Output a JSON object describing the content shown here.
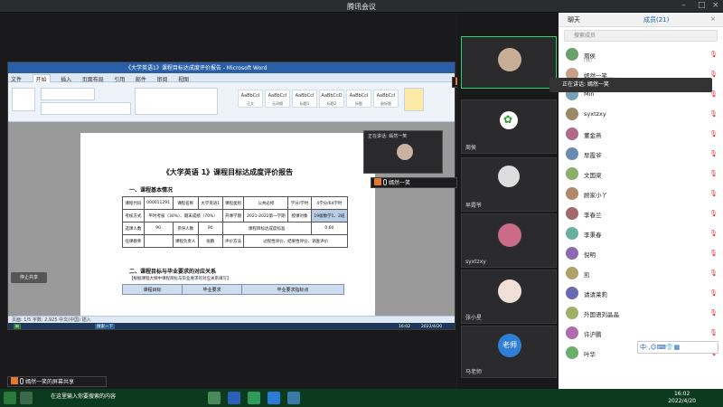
{
  "app": {
    "title": "腾讯会议"
  },
  "word": {
    "title": "《大学英语1》课程目标达成度评价报告 - Microsoft Word",
    "tabs": [
      "文件",
      "开始",
      "插入",
      "页面布局",
      "引用",
      "邮件",
      "审阅",
      "视图"
    ],
    "styles": [
      {
        "sample": "AaBbCcI",
        "name": "正文"
      },
      {
        "sample": "AaBbCcI",
        "name": "无间隔"
      },
      {
        "sample": "AaBbCcI",
        "name": "标题1"
      },
      {
        "sample": "AaBbCcD",
        "name": "标题2"
      },
      {
        "sample": "AaBbCcI",
        "name": "标题"
      },
      {
        "sample": "AaBbCcI",
        "name": "副标题"
      }
    ],
    "doc": {
      "title": "《大学英语 1》课程目标达成度评价报告",
      "sec1": "一、课程基本情况",
      "row1": [
        "课程代码",
        "000011291",
        "课程名称",
        "大学英语1",
        "课程类别",
        "公共必修",
        "学分/学时",
        "4学分/64学时"
      ],
      "row2": [
        "考核方式",
        "平时考核（30%）、期末成绩（70%）",
        "开课学期",
        "2021-2022第一学期",
        "授课对象",
        "19级数学1、2班"
      ],
      "row3": [
        "选课人数",
        "90",
        "参评人数",
        "90",
        "课程目标达成度标准",
        "0.60"
      ],
      "row4": [
        "任课教师",
        "",
        "课程负责人",
        "张鹏",
        "评价方法",
        "过程性评价、结果性评价、调查评价"
      ],
      "sec2": "二、课程目标与毕业要求的对应关系",
      "note": "【根据课程大纲中课程目标与毕业要求的对应关系填写】",
      "gheaders": [
        "课程目标",
        "毕业要求",
        "毕业要求指标点"
      ],
      "status": "页面: 1/5   字数: 2,925   中文(中国)   插入"
    },
    "stop_share": "停止共享",
    "task_start": "搜索一下",
    "task_time": "16:02",
    "task_date": "2022/4/20"
  },
  "share_label": "嫣然一笑的屏幕共享",
  "speaking": "正在讲话: 嫣然一笑",
  "speaker_name": "嫣然一笑",
  "videos": [
    {
      "name": ""
    },
    {
      "name": "周侯"
    },
    {
      "name": "早霞爷"
    },
    {
      "name": "syxtzxy"
    },
    {
      "name": "张小星"
    },
    {
      "name": "马老师",
      "badge": "老师"
    }
  ],
  "panel": {
    "tab_chat": "聊天",
    "tab_members": "成员(21)",
    "search_placeholder": "搜索成员",
    "members": [
      {
        "name": "周侯",
        "role": "(我)"
      },
      {
        "name": "嫣然一笑",
        "role": "(主持人，屏幕共享中)"
      },
      {
        "name": "Min",
        "role": ""
      },
      {
        "name": "syxtzxy",
        "role": ""
      },
      {
        "name": "董金燕",
        "role": ""
      },
      {
        "name": "早霞爷",
        "role": ""
      },
      {
        "name": "文国梁",
        "role": ""
      },
      {
        "name": "顾家小丫",
        "role": ""
      },
      {
        "name": "李春兰",
        "role": ""
      },
      {
        "name": "李秉春",
        "role": ""
      },
      {
        "name": "倪明",
        "role": ""
      },
      {
        "name": "凯",
        "role": ""
      },
      {
        "name": "请请莱莉",
        "role": ""
      },
      {
        "name": "外国语刘晶晶",
        "role": ""
      },
      {
        "name": "许沪鹏",
        "role": ""
      },
      {
        "name": "叶华",
        "role": ""
      }
    ],
    "speaking_tip": "正在讲话: 嫣然一笑",
    "ime": "中·,☺⌨👕▦"
  },
  "taskbar": {
    "caption": "在这里输入你要搜索的内容",
    "time": "16:02",
    "date": "2022/4/20"
  },
  "colors": {
    "accent": "#2a5fa8",
    "taskbar": "#0b3a1e",
    "share": "#e07a2e"
  }
}
